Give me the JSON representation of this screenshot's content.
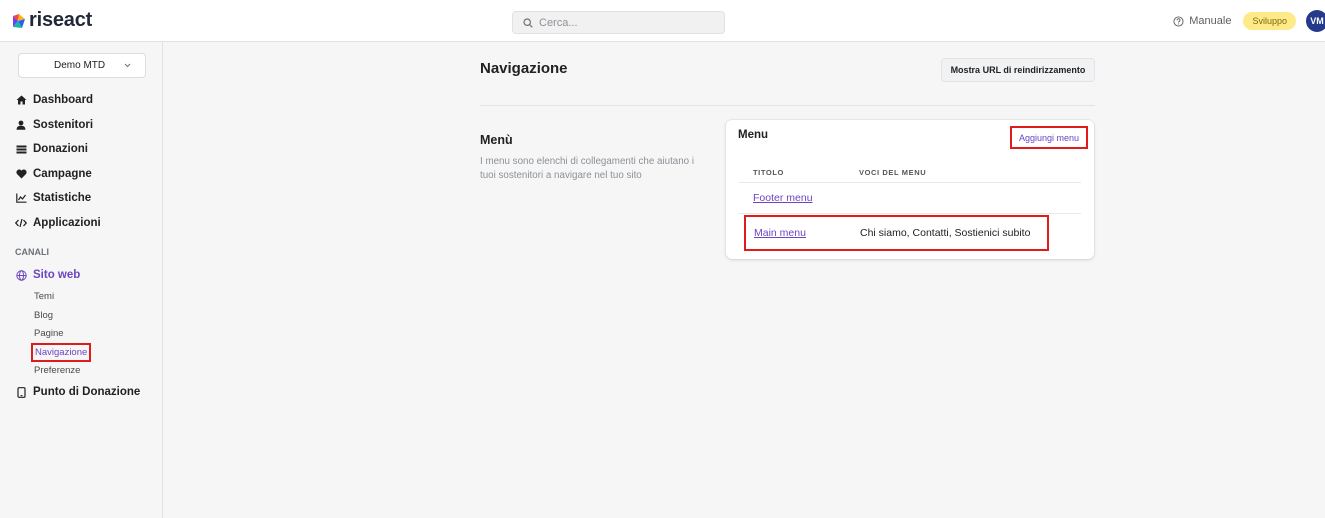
{
  "brand": {
    "name": "riseact"
  },
  "search": {
    "placeholder": "Cerca..."
  },
  "header": {
    "manual_label": "Manuale",
    "env_badge": "Sviluppo",
    "avatar_initials": "VM"
  },
  "sidebar": {
    "org_selector": "Demo MTD",
    "items": [
      {
        "label": "Dashboard",
        "icon": "home-icon"
      },
      {
        "label": "Sostenitori",
        "icon": "user-icon"
      },
      {
        "label": "Donazioni",
        "icon": "money-icon"
      },
      {
        "label": "Campagne",
        "icon": "heart-icon"
      },
      {
        "label": "Statistiche",
        "icon": "chart-icon"
      },
      {
        "label": "Applicazioni",
        "icon": "code-icon"
      }
    ],
    "channels_label": "CANALI",
    "website": {
      "label": "Sito web",
      "icon": "globe-icon",
      "sub_items": [
        "Temi",
        "Blog",
        "Pagine",
        "Navigazione",
        "Preferenze"
      ],
      "active": "Navigazione"
    },
    "pos": {
      "label": "Punto di Donazione",
      "icon": "device-icon"
    }
  },
  "main": {
    "title": "Navigazione",
    "redirect_button": "Mostra URL di reindirizzamento",
    "section": {
      "title": "Menù",
      "description": "I menu sono elenchi di collegamenti che aiutano i tuoi sostenitori a navigare nel tuo sito"
    },
    "card": {
      "title": "Menu",
      "add_button": "Aggiungi menu",
      "columns": [
        "TITOLO",
        "VOCI DEL MENU"
      ],
      "rows": [
        {
          "title": "Footer menu",
          "items": ""
        },
        {
          "title": "Main menu",
          "items": "Chi siamo, Contatti, Sostienici subito"
        }
      ]
    }
  },
  "colors": {
    "accent": "#6b46c1",
    "highlight": "#e01b1b",
    "badge": "#ffea8a",
    "avatar": "#253a8a"
  }
}
